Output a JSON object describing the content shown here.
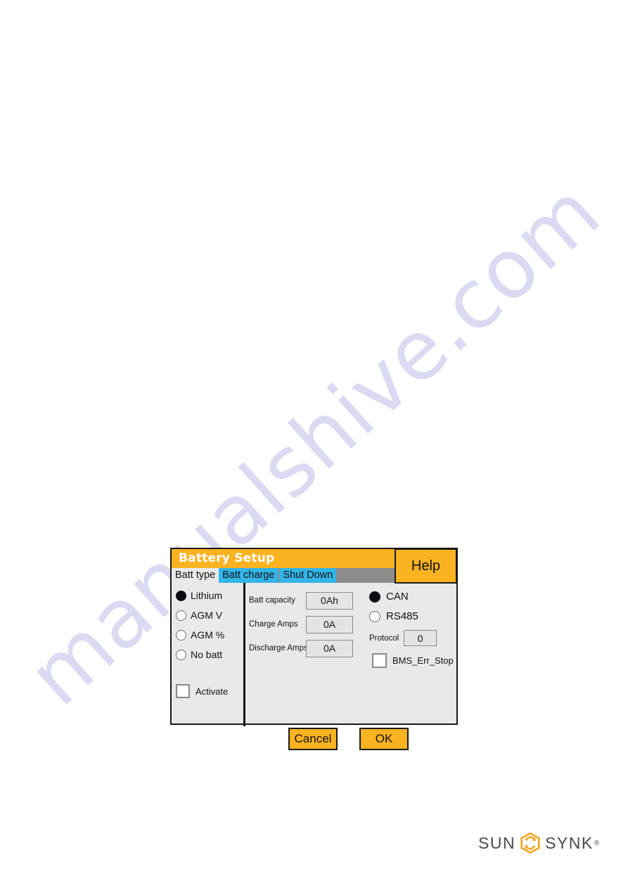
{
  "page": {
    "watermark_text": "manualshive.com"
  },
  "dialog": {
    "title": "Battery Setup",
    "help_label": "Help",
    "tabs": [
      {
        "label": "Batt type",
        "state": "active"
      },
      {
        "label": "Batt charge",
        "state": "inactive"
      },
      {
        "label": "Shut Down",
        "state": "inactive"
      }
    ],
    "battery_types": [
      {
        "label": "Lithium",
        "selected": true
      },
      {
        "label": "AGM V",
        "selected": false
      },
      {
        "label": "AGM %",
        "selected": false
      },
      {
        "label": "No batt",
        "selected": false
      }
    ],
    "activate": {
      "label": "Activate",
      "checked": false
    },
    "fields": [
      {
        "label": "Batt capacity",
        "value": "0Ah"
      },
      {
        "label": "Charge Amps",
        "value": "0A"
      },
      {
        "label": "Discharge Amps",
        "value": "0A"
      }
    ],
    "comms": [
      {
        "label": "CAN",
        "selected": true
      },
      {
        "label": "RS485",
        "selected": false
      }
    ],
    "protocol": {
      "label": "Protocol",
      "value": "0"
    },
    "bms_err_stop": {
      "label": "BMS_Err_Stop",
      "checked": false
    },
    "buttons": {
      "cancel": "Cancel",
      "ok": "OK"
    },
    "colors": {
      "accent_orange": "#fbb321",
      "tab_blue": "#33b5e8",
      "tab_bar_gray": "#8c8c8c",
      "panel_gray": "#e9e9e9",
      "border_dark": "#1a1a1a"
    }
  },
  "logo": {
    "word_left": "SUN",
    "word_right": "SYNK",
    "registered": "®",
    "mark_name": "sunsynk-hexagon-recycle-icon",
    "mark_color": "#f0a726"
  }
}
